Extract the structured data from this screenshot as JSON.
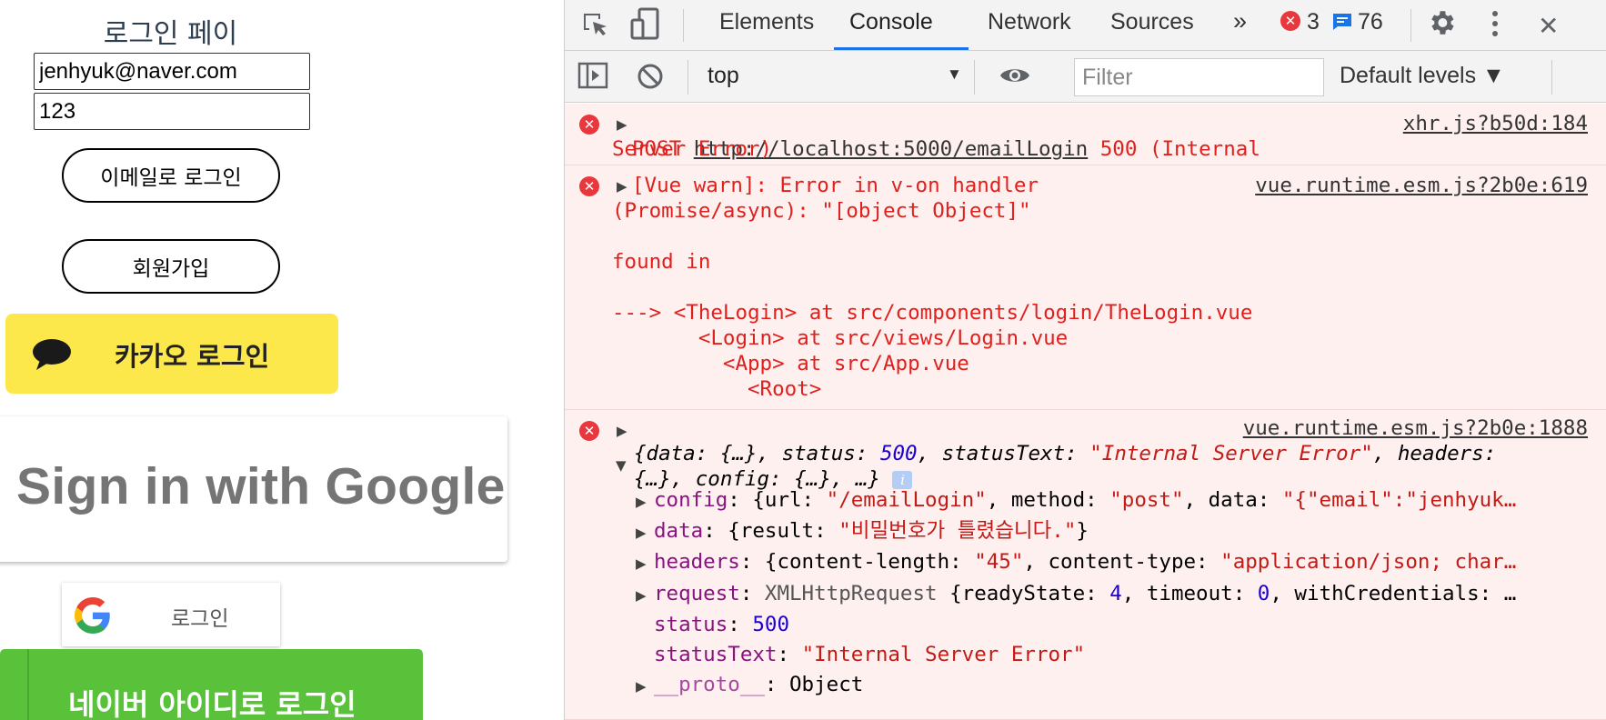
{
  "login_page": {
    "title": "로그인 페이지",
    "email_value": "jenhyuk@naver.com",
    "password_value": "123",
    "email_login_button": "이메일로 로그인",
    "signup_button": "회원가입",
    "kakao_button": "카카오 로그인",
    "google_big_button": "Sign in with Google",
    "google_small_button": "로그인",
    "naver_button": "네이버 아이디로 로그인",
    "colors": {
      "kakao": "#fde84b",
      "naver": "#59c13a"
    }
  },
  "devtools": {
    "tabs": [
      "Elements",
      "Console",
      "Network",
      "Sources"
    ],
    "active_tab": "Console",
    "more_tabs_icon": "»",
    "error_count": "3",
    "message_count": "76",
    "context": "top",
    "filter_placeholder": "Filter",
    "levels": "Default levels"
  },
  "console": {
    "msg1": {
      "method": "POST",
      "url": "http://localhost:5000/emailLogin",
      "status": "500 (Internal",
      "status_cont": "Server Error)",
      "source": "xhr.js?b50d:184"
    },
    "msg2": {
      "line1": "[Vue warn]: Error in v-on handler",
      "line2": "(Promise/async): \"[object Object]\"",
      "found_in": "found in",
      "trace": [
        "---> <TheLogin> at src/components/login/TheLogin.vue",
        "       <Login> at src/views/Login.vue",
        "         <App> at src/App.vue",
        "           <Root>"
      ],
      "source": "vue.runtime.esm.js?2b0e:619"
    },
    "msg3": {
      "source": "vue.runtime.esm.js?2b0e:1888",
      "summary_line1": {
        "k_data": "data",
        "v_data": "{…}",
        "k_status": "status",
        "v_status": "500",
        "k_statusText": "statusText",
        "v_statusText": "\"Internal Server Error\"",
        "k_headers": "headers:"
      },
      "summary_line2": {
        "v_headers": "{…}",
        "k_config": "config",
        "v_config": "{…}",
        "rest": "…}"
      },
      "props": {
        "config": {
          "key": "config",
          "val_pre": "{url: ",
          "url": "\"/emailLogin\"",
          "mid": ", method: ",
          "method": "\"post\"",
          "mid2": ", data: ",
          "data": "\"{\"email\":\"jenhyuk…"
        },
        "data": {
          "key": "data",
          "val_pre": "{result: ",
          "result": "\"비밀번호가 틀렸습니다.\"",
          "val_post": "}"
        },
        "headers": {
          "key": "headers",
          "val_pre": "{content-length: ",
          "cl": "\"45\"",
          "mid": ", content-type: ",
          "ct": "\"application/json; char…"
        },
        "request": {
          "key": "request",
          "cls": "XMLHttpRequest",
          "pre": " {readyState: ",
          "rs": "4",
          "mid": ", timeout: ",
          "to": "0",
          "tail": ", withCredentials: …"
        },
        "status": {
          "key": "status",
          "val": "500"
        },
        "statusText": {
          "key": "statusText",
          "val": "\"Internal Server Error\""
        },
        "proto": {
          "key": "__proto__",
          "val": "Object"
        }
      }
    }
  }
}
